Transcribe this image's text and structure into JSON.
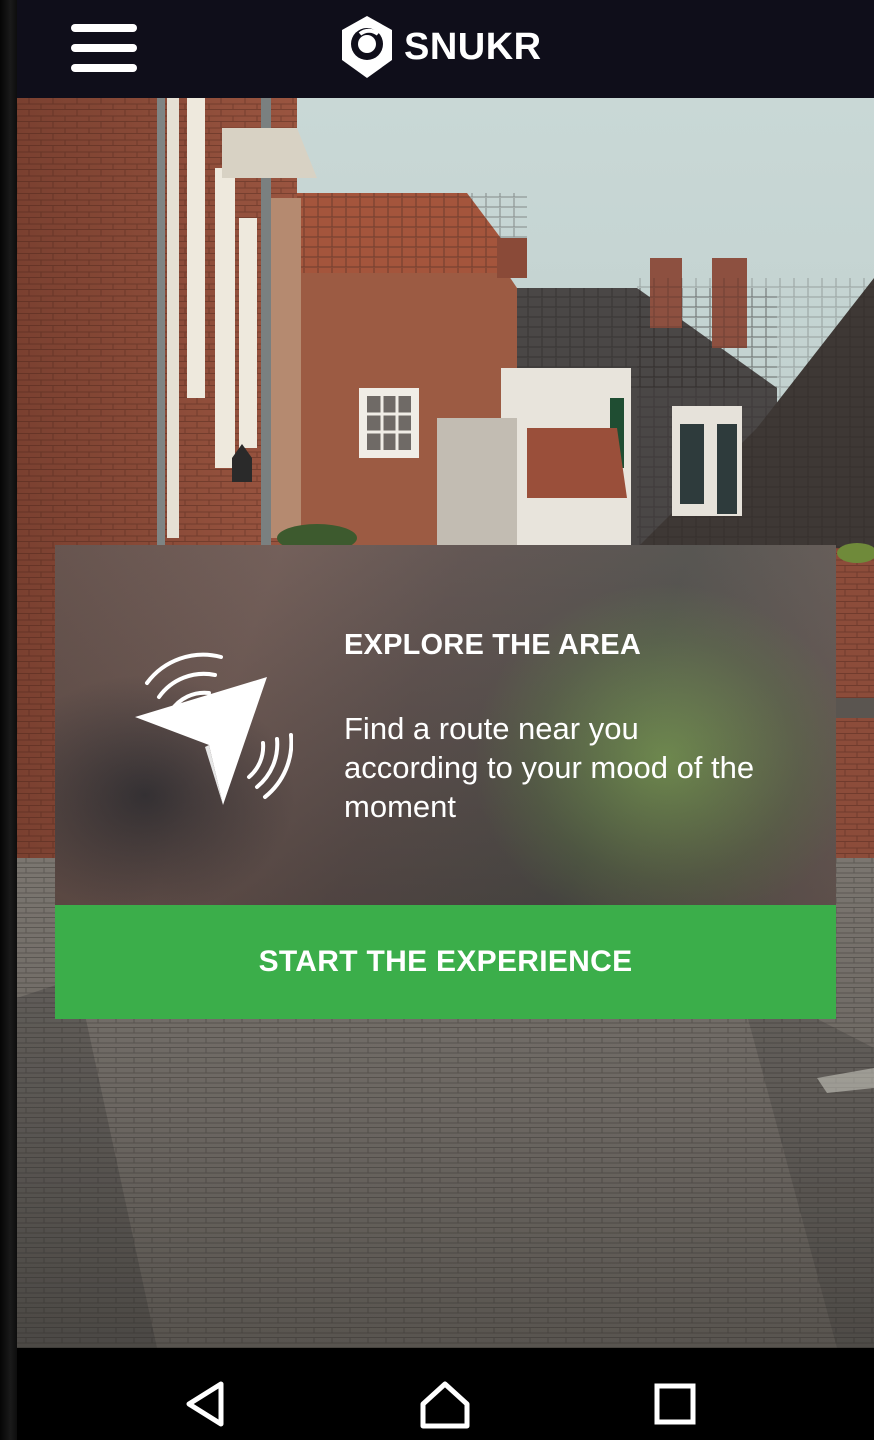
{
  "app_bar": {
    "brand_name": "SNUKR",
    "menu_icon": "hamburger-menu-icon",
    "logo_icon": "location-pin-logo-icon",
    "background_color": "#0f0e1a"
  },
  "card": {
    "icon": "navigation-arrow-signal-icon",
    "title": "EXPLORE THE AREA",
    "description": "Find a route near you according to your mood of the moment",
    "button_label": "START THE EXPERIENCE",
    "button_color": "#3bae4a"
  },
  "system_nav": {
    "back_icon": "back-triangle-icon",
    "home_icon": "home-icon",
    "recents_icon": "recents-square-icon"
  }
}
